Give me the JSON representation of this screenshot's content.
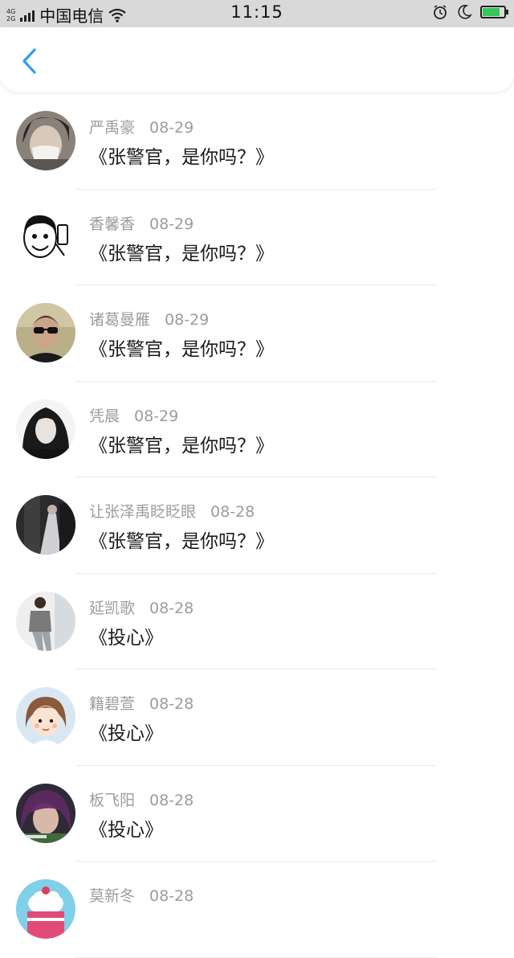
{
  "status_bar": {
    "network": [
      "4G",
      "2G"
    ],
    "carrier": "中国电信",
    "time": "11:15",
    "battery_level": 0.8,
    "battery_color": "#34c759",
    "icons": [
      "signal-icon",
      "wifi-icon",
      "alarm-icon",
      "moon-icon",
      "battery-icon"
    ]
  },
  "header": {
    "back_icon": "chevron-left-icon",
    "accent": "#2a9ff5"
  },
  "comments": [
    {
      "user": "严禹豪",
      "date": "08-29",
      "text": "《张警官，是你吗？》",
      "avatar": "masked-person"
    },
    {
      "user": "香馨香",
      "date": "08-29",
      "text": "《张警官，是你吗？》",
      "avatar": "cartoon-selfie"
    },
    {
      "user": "诸葛曼雁",
      "date": "08-29",
      "text": "《张警官，是你吗？》",
      "avatar": "man-sunglasses"
    },
    {
      "user": "凭晨",
      "date": "08-29",
      "text": "《张警官，是你吗？》",
      "avatar": "long-hair-girl"
    },
    {
      "user": "让张泽禹眨眨眼",
      "date": "08-28",
      "text": "《张警官，是你吗？》",
      "avatar": "dark-photo"
    },
    {
      "user": "延凯歌",
      "date": "08-28",
      "text": "《投心》",
      "avatar": "standing-man"
    },
    {
      "user": "籍碧萱",
      "date": "08-28",
      "text": "《投心》",
      "avatar": "cartoon-girl"
    },
    {
      "user": "板飞阳",
      "date": "08-28",
      "text": "《投心》",
      "avatar": "purple-hair"
    },
    {
      "user": "莫新冬",
      "date": "08-28",
      "text": "",
      "avatar": "cake"
    }
  ]
}
